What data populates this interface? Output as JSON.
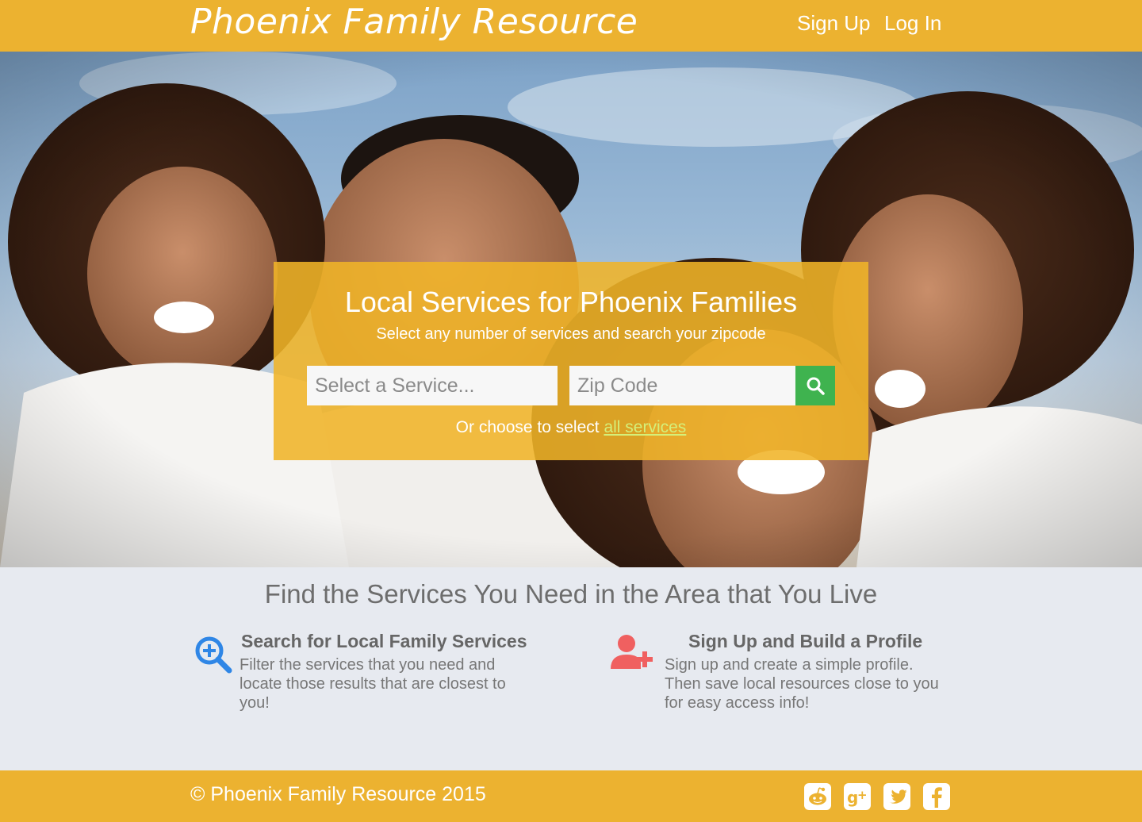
{
  "header": {
    "brand": "Phoenix Family Resource",
    "nav": {
      "signup": "Sign Up",
      "login": "Log In"
    }
  },
  "hero": {
    "title": "Local Services for Phoenix Families",
    "subtitle": "Select any number of services and search your zipcode",
    "service_placeholder": "Select a Service...",
    "zip_placeholder": "Zip Code",
    "choose_prefix": "Or choose to select ",
    "choose_link": "all services"
  },
  "features": {
    "title": "Find the Services You Need in the Area that You Live",
    "items": [
      {
        "icon": "zoom-in-icon",
        "heading": "Search for Local Family Services",
        "body": "Filter the services that you need and locate those results that are closest to you!"
      },
      {
        "icon": "add-user-icon",
        "heading": "Sign Up and Build a Profile",
        "body": "Sign up and create a simple profile. Then save local resources close to you for easy access info!"
      }
    ]
  },
  "footer": {
    "copyright": "© Phoenix Family Resource 2015",
    "social": [
      "reddit-icon",
      "google-plus-icon",
      "twitter-icon",
      "facebook-icon"
    ]
  },
  "colors": {
    "accent": "#ecb230",
    "search_button": "#3fb34f",
    "feature_blue": "#2f86e6",
    "feature_red": "#f06060",
    "section_bg": "#e7eaf0"
  }
}
